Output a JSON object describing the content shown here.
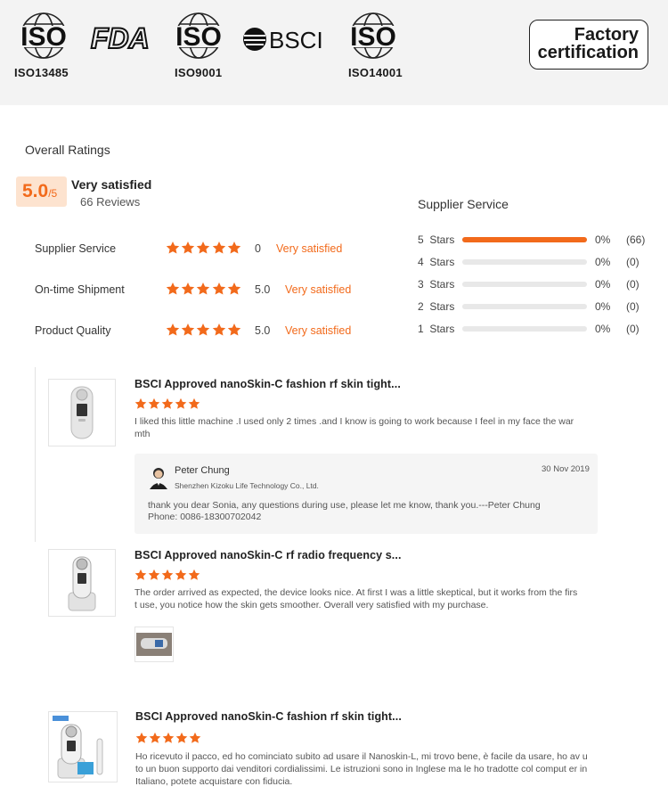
{
  "certifications": {
    "iso_word": "ISO",
    "iso1_caption": "ISO13485",
    "fda_text": "FDA",
    "iso2_caption": "ISO9001",
    "bsci_text": "BSCI",
    "iso3_caption": "ISO14001",
    "factory_line1": "Factory",
    "factory_line2": "certification"
  },
  "ratings": {
    "title": "Overall Ratings",
    "score": "5.0",
    "score_suffix": "/5",
    "score_text": "Very satisfied",
    "review_count": "66 Reviews",
    "metrics": [
      {
        "label": "Supplier Service",
        "stars": 5,
        "score": "0",
        "desc": "Very satisfied"
      },
      {
        "label": "On-time Shipment",
        "stars": 5,
        "score": "5.0",
        "desc": "Very satisfied"
      },
      {
        "label": "Product Quality",
        "stars": 5,
        "score": "5.0",
        "desc": "Very satisfied"
      }
    ],
    "distribution_title": "Supplier Service",
    "distribution": [
      {
        "label": "5  Stars",
        "fill": 1.0,
        "pct": "0%",
        "count": "(66)"
      },
      {
        "label": "4  Stars",
        "fill": 0.0,
        "pct": "0%",
        "count": "(0)"
      },
      {
        "label": "3  Stars",
        "fill": 0.0,
        "pct": "0%",
        "count": "(0)"
      },
      {
        "label": "2  Stars",
        "fill": 0.0,
        "pct": "0%",
        "count": "(0)"
      },
      {
        "label": "1  Stars",
        "fill": 0.0,
        "pct": "0%",
        "count": "(0)"
      }
    ]
  },
  "reviews": [
    {
      "title": "BSCI Approved nanoSkin-C fashion rf skin tight...",
      "stars": 5,
      "text": "I liked this little machine .I used only 2 times .and I know is going to work because I feel in my face the war mth",
      "reply": {
        "name": "Peter Chung",
        "company": "Shenzhen Kizoku Life Technology Co., Ltd.",
        "date": "30 Nov 2019",
        "message": "thank you dear Sonia, any questions during use, please let me know, thank you.---Peter Chung",
        "phone": "Phone: 0086-18300702042"
      }
    },
    {
      "title": "BSCI Approved nanoSkin-C rf radio frequency s...",
      "stars": 5,
      "text": "The order arrived as expected, the device looks nice. At first I was a little skeptical, but it works from the firs t use, you notice how the skin gets smoother. Overall very satisfied with my purchase."
    },
    {
      "title": "BSCI Approved nanoSkin-C fashion rf skin tight...",
      "stars": 5,
      "text": "Ho ricevuto il pacco, ed ho cominciato subito ad usare il Nanoskin-L, mi trovo bene, è facile da usare, ho av uto un buon supporto dai venditori cordialissimi. Le istruzioni sono in Inglese ma le ho tradotte col comput er in Italiano, potete acquistare con fiducia."
    }
  ],
  "colors": {
    "accent": "#f26a1b",
    "score_bg": "#fde3cf",
    "header_bg": "#f3f3f3",
    "reply_bg": "#f5f5f5"
  },
  "icons": [
    "iso-logo-icon",
    "fda-logo-icon",
    "bsci-logo-icon",
    "star-icon",
    "avatar-icon",
    "product-device-icon"
  ]
}
